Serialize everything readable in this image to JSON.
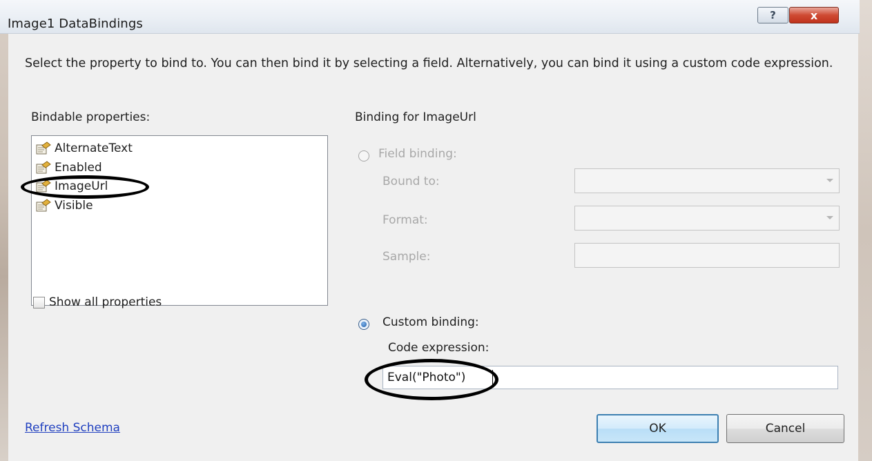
{
  "window": {
    "title": "Image1 DataBindings",
    "help_glyph": "?",
    "close_glyph": "x"
  },
  "instructions": "Select the property to bind to. You can then bind it by selecting a field. Alternatively, you can bind it using a custom code expression.",
  "left_panel": {
    "heading": "Bindable properties:",
    "properties": [
      {
        "label": "AlternateText",
        "icon": "property-icon"
      },
      {
        "label": "Enabled",
        "icon": "property-icon"
      },
      {
        "label": "ImageUrl",
        "icon": "property-icon"
      },
      {
        "label": "Visible",
        "icon": "property-icon"
      }
    ],
    "show_all_label": "Show all properties",
    "show_all_checked": false
  },
  "right_panel": {
    "heading": "Binding for ImageUrl",
    "field_binding": {
      "label": "Field binding:",
      "selected": false,
      "enabled": false,
      "bound_to_label": "Bound to:",
      "format_label": "Format:",
      "sample_label": "Sample:"
    },
    "custom_binding": {
      "label": "Custom binding:",
      "selected": true,
      "code_label": "Code expression:",
      "code_value": "Eval(\"Photo\")"
    }
  },
  "footer": {
    "refresh_link": "Refresh Schema",
    "ok_label": "OK",
    "cancel_label": "Cancel"
  },
  "annotations": {
    "highlight_color": "#000000",
    "circled_items": [
      "ImageUrl",
      "Eval(\"Photo\")"
    ]
  },
  "colors": {
    "link": "#1f3fbf",
    "ok_border": "#3c7fb1",
    "close_button": "#c0331d"
  }
}
